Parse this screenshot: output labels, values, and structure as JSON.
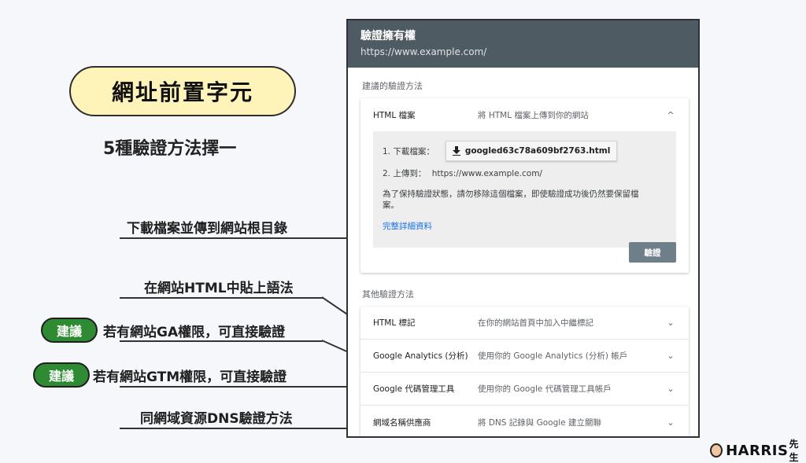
{
  "left": {
    "title": "網址前置字元",
    "subtitle": "5種驗證方法擇一"
  },
  "annotations": [
    {
      "text": "下載檔案並傳到網站根目錄"
    },
    {
      "text": "在網站HTML中貼上語法"
    },
    {
      "badge": "建議",
      "text": "若有網站GA權限，可直接驗證"
    },
    {
      "badge": "建議",
      "text": "若有網站GTM權限，可直接驗證"
    },
    {
      "text": "同網域資源DNS驗證方法"
    }
  ],
  "panel": {
    "title": "驗證擁有權",
    "url": "https://www.example.com/",
    "recommended_label": "建議的驗證方法",
    "other_label": "其他驗證方法",
    "html_file": {
      "name": "HTML 檔案",
      "desc": "將 HTML 檔案上傳到你的網站",
      "chevron": "^",
      "step1_label": "1. 下載檔案：",
      "file_name": "googled63c78a609bf2763.html",
      "step2_label": "2. 上傳到：",
      "step2_url": "https://www.example.com/",
      "note": "為了保持驗證狀態，請勿移除這個檔案，即使驗證成功後仍然要保留檔案。",
      "details_link": "完整詳細資料",
      "verify_button": "驗證"
    },
    "other_methods": [
      {
        "name": "HTML 標記",
        "desc": "在你的網站首頁中加入中繼標記",
        "chevron": "⌄"
      },
      {
        "name": "Google Analytics (分析)",
        "desc": "使用你的 Google Analytics (分析) 帳戶",
        "chevron": "⌄"
      },
      {
        "name": "Google 代碼管理工具",
        "desc": "使用你的 Google 代碼管理工具帳戶",
        "chevron": "⌄"
      },
      {
        "name": "網域名稱供應商",
        "desc": "將 DNS 記錄與 Google 建立關聯",
        "chevron": "⌄"
      }
    ]
  },
  "logo": {
    "text": "HARRIS",
    "suffix": "先生"
  }
}
